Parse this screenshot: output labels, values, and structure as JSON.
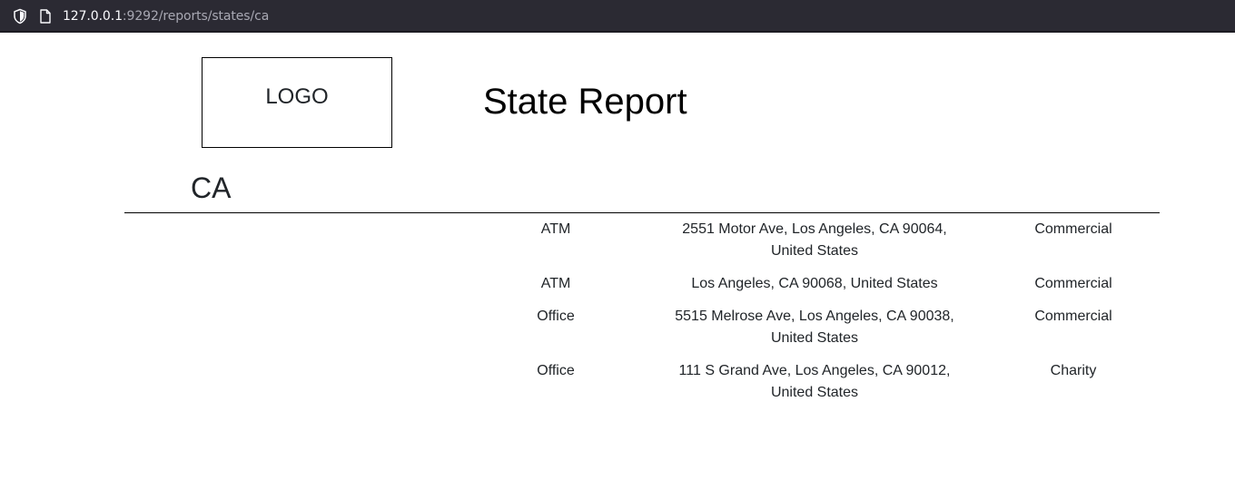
{
  "browser": {
    "url_host": "127.0.0.1",
    "url_rest": ":9292/reports/states/ca"
  },
  "header": {
    "logo_text": "LOGO",
    "title": "State Report"
  },
  "state": {
    "code": "CA"
  },
  "rows": [
    {
      "type": "ATM",
      "address": "2551 Motor Ave, Los Angeles, CA 90064, United States",
      "category": "Commercial"
    },
    {
      "type": "ATM",
      "address": "Los Angeles, CA 90068, United States",
      "category": "Commercial"
    },
    {
      "type": "Office",
      "address": "5515 Melrose Ave, Los Angeles, CA 90038, United States",
      "category": "Commercial"
    },
    {
      "type": "Office",
      "address": "111 S Grand Ave, Los Angeles, CA 90012, United States",
      "category": "Charity"
    }
  ]
}
